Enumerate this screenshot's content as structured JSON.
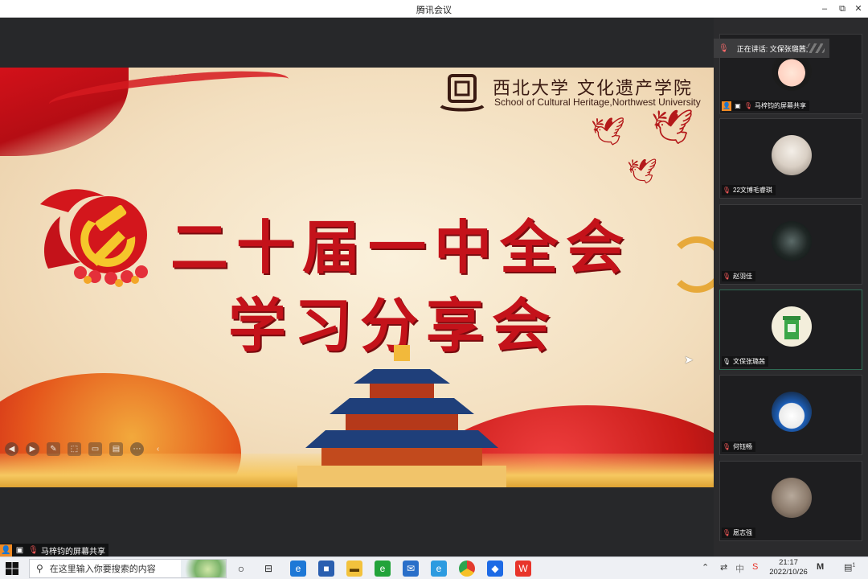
{
  "window": {
    "title": "腾讯会议",
    "minimize": "–",
    "restore": "⧉",
    "close": "✕"
  },
  "slide": {
    "school_cn": "西北大学 文化遗产学院",
    "school_en": "School of Cultural Heritage,Northwest University",
    "title_line1": "二十届一中全会",
    "title_line2": "学习分享会"
  },
  "slide_controls": [
    "prev-icon",
    "next-icon",
    "pen-icon",
    "select-icon",
    "screen-icon",
    "comment-icon",
    "more-icon",
    "collapse-icon"
  ],
  "presenter_tag": {
    "name": "马梓钧的屏幕共享"
  },
  "speaking": {
    "label": "正在讲话: 文保张璐茜;"
  },
  "participants": [
    {
      "name": "马梓钧的屏幕共享",
      "avatar": "cartoon-girl-avatar",
      "sharing": true,
      "muted": true
    },
    {
      "name": "22文博毛睿琪",
      "avatar": "cat-photo-avatar",
      "muted": true
    },
    {
      "name": "赵羽佳",
      "avatar": "night-scene-avatar",
      "muted": true
    },
    {
      "name": "文保张璐茜",
      "avatar": "trash-bin-avatar",
      "muted": false,
      "active": true
    },
    {
      "name": "何钰畅",
      "avatar": "anime-girl-avatar",
      "muted": true
    },
    {
      "name": "扈志强",
      "avatar": "person-photo-avatar",
      "muted": true
    }
  ],
  "taskbar": {
    "search_placeholder": "在这里输入你要搜索的内容",
    "ime_label": "中",
    "time": "21:17",
    "date": "2022/10/26",
    "notification_count": "1"
  },
  "colors": {
    "accent_red": "#c4121a",
    "sidebar_bg": "#2b2b2d",
    "stage_bg": "#27282a"
  }
}
